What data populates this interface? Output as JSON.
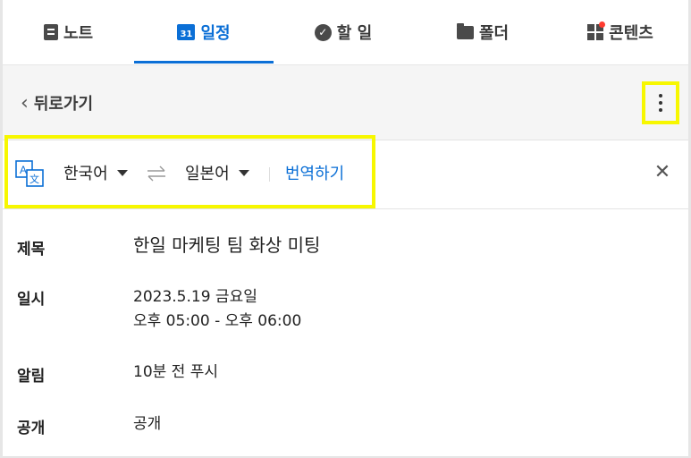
{
  "tabs": [
    {
      "label": "노트",
      "icon": "note-icon"
    },
    {
      "label": "일정",
      "icon": "calendar-icon",
      "icon_text": "31",
      "active": true
    },
    {
      "label": "할 일",
      "icon": "check-circle-icon"
    },
    {
      "label": "폴더",
      "icon": "folder-icon"
    },
    {
      "label": "콘텐츠",
      "icon": "content-grid-icon"
    }
  ],
  "back": {
    "label": "뒤로가기"
  },
  "translate": {
    "source_lang": "한국어",
    "target_lang": "일본어",
    "action_label": "번역하기"
  },
  "details": {
    "title_key": "제목",
    "title_value": "한일 마케팅 팀 화상 미팅",
    "date_key": "일시",
    "date_line1": "2023.5.19 금요일",
    "date_line2": "오후 05:00 - 오후 06:00",
    "alarm_key": "알림",
    "alarm_value": "10분 전 푸시",
    "visibility_key": "공개",
    "visibility_value": "공개"
  },
  "colors": {
    "accent": "#0b6fd6",
    "highlight": "#f7f700"
  }
}
